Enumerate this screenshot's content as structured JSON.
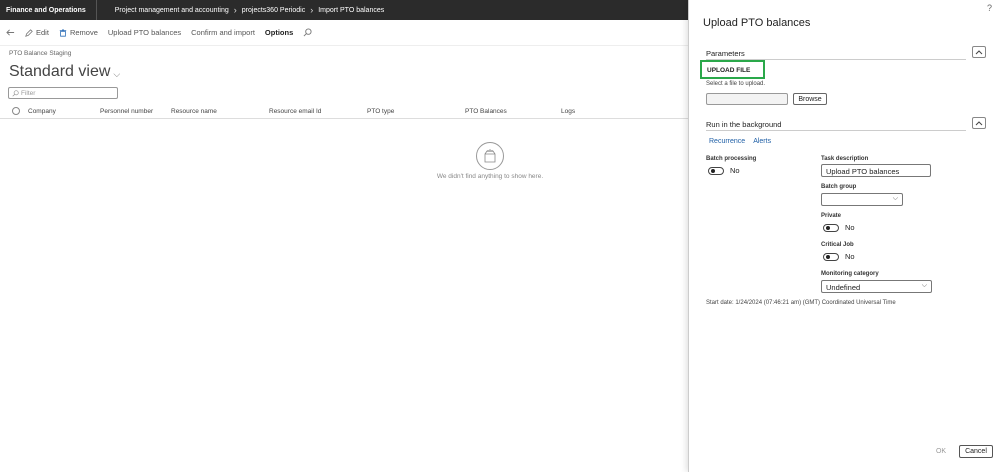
{
  "topbar": {
    "app_name": "Finance and Operations",
    "crumbs": [
      "Project management and accounting",
      "projects360 Periodic",
      "Import PTO balances"
    ]
  },
  "actions": {
    "edit": "Edit",
    "remove": "Remove",
    "upload": "Upload PTO balances",
    "confirm": "Confirm and import",
    "options": "Options"
  },
  "page": {
    "staging": "PTO Balance Staging",
    "view_title": "Standard view",
    "filter_placeholder": "Filter"
  },
  "grid": {
    "columns": [
      "Company",
      "Personnel number",
      "Resource name",
      "Resource email Id",
      "PTO type",
      "PTO Balances",
      "Logs"
    ],
    "empty_text": "We didn't find anything to show here."
  },
  "panel": {
    "help": "?",
    "title": "Upload PTO balances",
    "parameters_head": "Parameters",
    "upload_file_label": "UPLOAD FILE",
    "select_hint": "Select a file to upload.",
    "browse": "Browse",
    "background_head": "Run in the background",
    "tabs": [
      "Recurrence",
      "Alerts"
    ],
    "batch_processing_label": "Batch processing",
    "batch_processing_value": "No",
    "task_description_label": "Task description",
    "task_description_value": "Upload PTO balances",
    "batch_group_label": "Batch group",
    "batch_group_value": "",
    "private_label": "Private",
    "private_value": "No",
    "critical_label": "Critical Job",
    "critical_value": "No",
    "monitoring_label": "Monitoring category",
    "monitoring_value": "Undefined",
    "start_date": "Start date: 1/24/2024 (07:46:21 am) (GMT) Coordinated Universal Time",
    "ok": "OK",
    "cancel": "Cancel"
  }
}
